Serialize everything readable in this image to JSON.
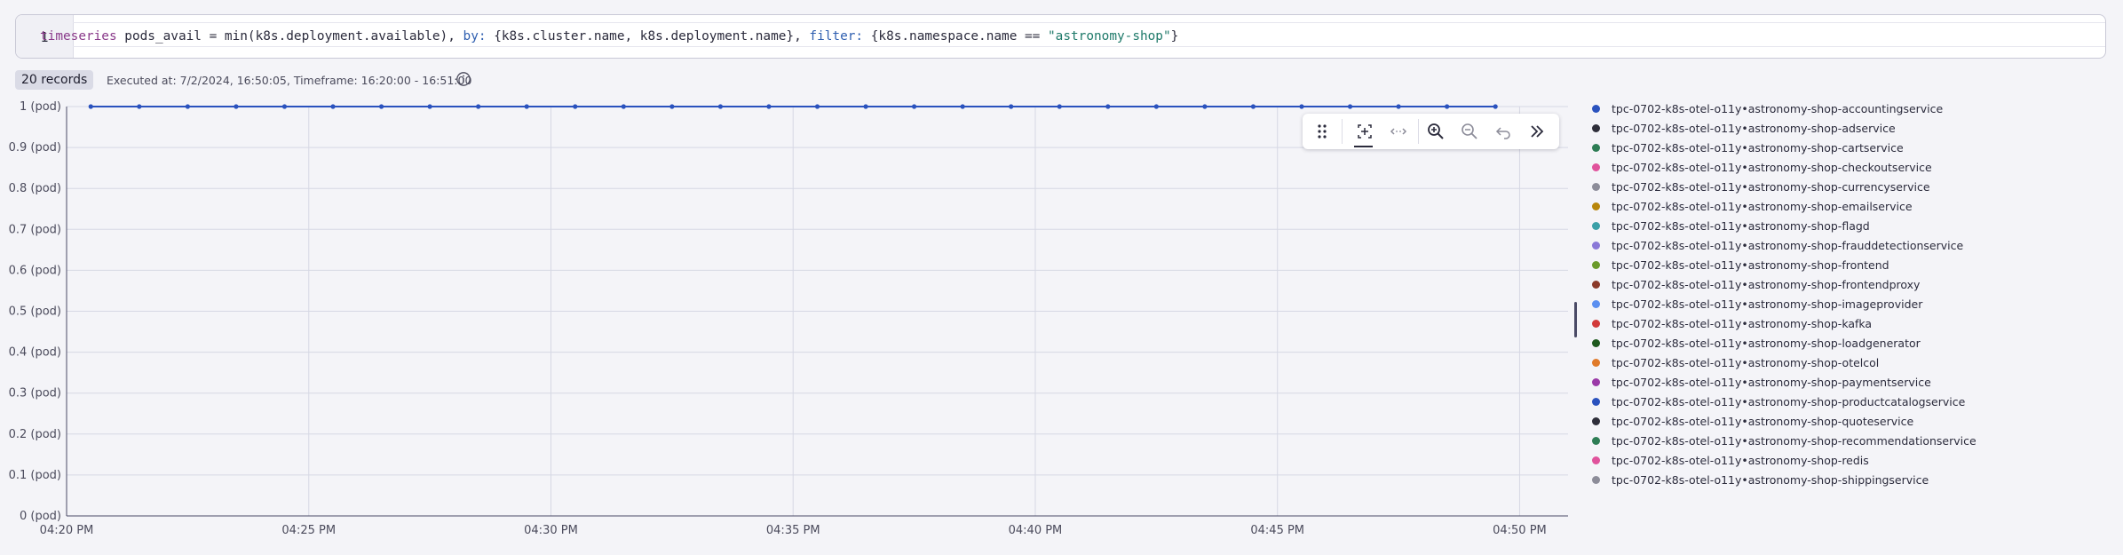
{
  "editor": {
    "line_number": "1",
    "code": {
      "t1": "timeseries",
      "t2": " pods_avail = min(k8s.deployment.available), ",
      "t3": "by:",
      "t4": " {k8s.cluster.name, k8s.deployment.name}, ",
      "t5": "filter:",
      "t6": " {k8s.namespace.name == ",
      "t7": "\"astronomy-shop\"",
      "t8": "}"
    }
  },
  "results": {
    "records_label": "20 records",
    "execution_info": "Executed at: 7/2/2024, 16:50:05, Timeframe: 16:20:00 - 16:51:00"
  },
  "toolbar": {
    "icons": [
      "drag-handle-icon",
      "select-zoom-icon",
      "pan-icon",
      "zoom-in-icon",
      "zoom-out-icon",
      "undo-icon",
      "collapse-icon"
    ]
  },
  "chart_data": {
    "type": "line",
    "y_ticks": [
      "0 (pod)",
      "0.1 (pod)",
      "0.2 (pod)",
      "0.3 (pod)",
      "0.4 (pod)",
      "0.5 (pod)",
      "0.6 (pod)",
      "0.7 (pod)",
      "0.8 (pod)",
      "0.9 (pod)",
      "1 (pod)"
    ],
    "y_tick_values": [
      0,
      0.1,
      0.2,
      0.3,
      0.4,
      0.5,
      0.6,
      0.7,
      0.8,
      0.9,
      1
    ],
    "ylim": [
      0,
      1
    ],
    "x_ticks": [
      "04:20 PM",
      "04:25 PM",
      "04:30 PM",
      "04:35 PM",
      "04:40 PM",
      "04:45 PM",
      "04:50 PM"
    ],
    "x_tick_values": [
      "16:20",
      "16:25",
      "16:30",
      "16:35",
      "16:40",
      "16:45",
      "16:50"
    ],
    "xlim": [
      "16:20",
      "16:51"
    ],
    "x": [
      "16:20:30",
      "16:21:30",
      "16:22:30",
      "16:23:30",
      "16:24:30",
      "16:25:30",
      "16:26:30",
      "16:27:30",
      "16:28:30",
      "16:29:30",
      "16:30:30",
      "16:31:30",
      "16:32:30",
      "16:33:30",
      "16:34:30",
      "16:35:30",
      "16:36:30",
      "16:37:30",
      "16:38:30",
      "16:39:30",
      "16:40:30",
      "16:41:30",
      "16:42:30",
      "16:43:30",
      "16:44:30",
      "16:45:30",
      "16:46:30",
      "16:47:30",
      "16:48:30",
      "16:49:30"
    ],
    "series_values": [
      1,
      1,
      1,
      1,
      1,
      1,
      1,
      1,
      1,
      1,
      1,
      1,
      1,
      1,
      1,
      1,
      1,
      1,
      1,
      1,
      1,
      1,
      1,
      1,
      1,
      1,
      1,
      1,
      1,
      1
    ],
    "grid": true,
    "legend_placement": "right",
    "series": [
      {
        "name": "tpc-0702-k8s-otel-o11y•astronomy-shop-accountingservice",
        "color": "#2a52be"
      },
      {
        "name": "tpc-0702-k8s-otel-o11y•astronomy-shop-adservice",
        "color": "#2e2e3a"
      },
      {
        "name": "tpc-0702-k8s-otel-o11y•astronomy-shop-cartservice",
        "color": "#2e7d55"
      },
      {
        "name": "tpc-0702-k8s-otel-o11y•astronomy-shop-checkoutservice",
        "color": "#e0529c"
      },
      {
        "name": "tpc-0702-k8s-otel-o11y•astronomy-shop-currencyservice",
        "color": "#8c8c99"
      },
      {
        "name": "tpc-0702-k8s-otel-o11y•astronomy-shop-emailservice",
        "color": "#b8860b"
      },
      {
        "name": "tpc-0702-k8s-otel-o11y•astronomy-shop-flagd",
        "color": "#3aa0a8"
      },
      {
        "name": "tpc-0702-k8s-otel-o11y•astronomy-shop-frauddetectionservice",
        "color": "#8a78d8"
      },
      {
        "name": "tpc-0702-k8s-otel-o11y•astronomy-shop-frontend",
        "color": "#6a9a2a"
      },
      {
        "name": "tpc-0702-k8s-otel-o11y•astronomy-shop-frontendproxy",
        "color": "#8b3a2a"
      },
      {
        "name": "tpc-0702-k8s-otel-o11y•astronomy-shop-imageprovider",
        "color": "#5b8ff0"
      },
      {
        "name": "tpc-0702-k8s-otel-o11y•astronomy-shop-kafka",
        "color": "#d23a3a"
      },
      {
        "name": "tpc-0702-k8s-otel-o11y•astronomy-shop-loadgenerator",
        "color": "#1f5a1f"
      },
      {
        "name": "tpc-0702-k8s-otel-o11y•astronomy-shop-otelcol",
        "color": "#e07a2a"
      },
      {
        "name": "tpc-0702-k8s-otel-o11y•astronomy-shop-paymentservice",
        "color": "#9b3aa8"
      },
      {
        "name": "tpc-0702-k8s-otel-o11y•astronomy-shop-productcatalogservice",
        "color": "#2a52be"
      },
      {
        "name": "tpc-0702-k8s-otel-o11y•astronomy-shop-quoteservice",
        "color": "#2e2e3a"
      },
      {
        "name": "tpc-0702-k8s-otel-o11y•astronomy-shop-recommendationservice",
        "color": "#2e7d55"
      },
      {
        "name": "tpc-0702-k8s-otel-o11y•astronomy-shop-redis",
        "color": "#e0529c"
      },
      {
        "name": "tpc-0702-k8s-otel-o11y•astronomy-shop-shippingservice",
        "color": "#8c8c99"
      }
    ]
  }
}
